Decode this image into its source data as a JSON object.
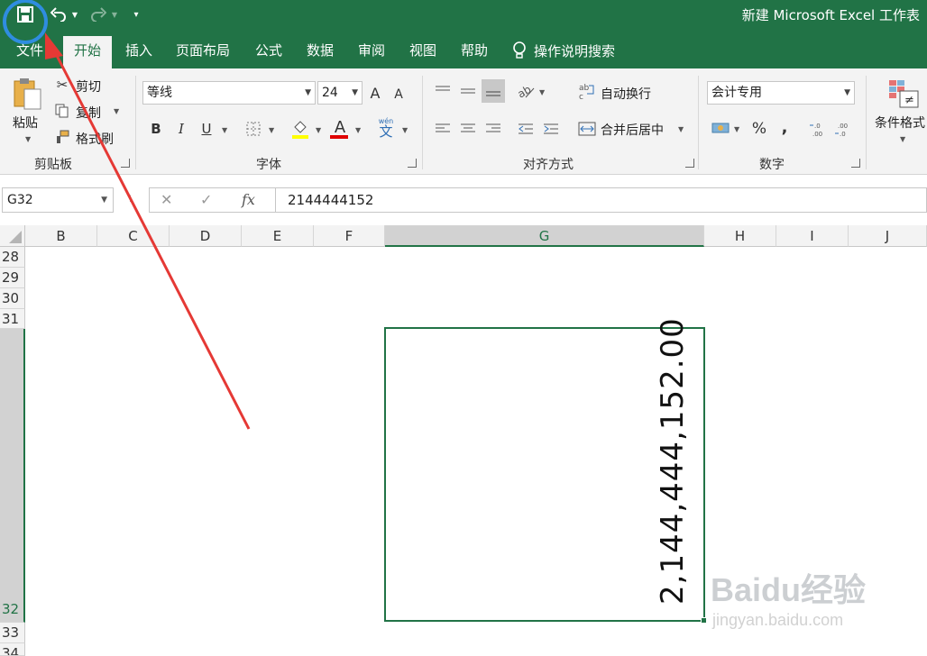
{
  "window": {
    "title": "新建 Microsoft Excel 工作表"
  },
  "tabs": [
    {
      "label": "文件"
    },
    {
      "label": "开始"
    },
    {
      "label": "插入"
    },
    {
      "label": "页面布局"
    },
    {
      "label": "公式"
    },
    {
      "label": "数据"
    },
    {
      "label": "审阅"
    },
    {
      "label": "视图"
    },
    {
      "label": "帮助"
    }
  ],
  "tell_me": {
    "label": "操作说明搜索"
  },
  "clipboard": {
    "paste": "粘贴",
    "cut": "剪切",
    "copy": "复制",
    "format_painter": "格式刷",
    "group": "剪贴板"
  },
  "font": {
    "name": "等线",
    "size": "24",
    "bold": "B",
    "italic": "I",
    "underline": "U",
    "grow": "A",
    "shrink": "A",
    "font_color": "A",
    "phonetic": "wén",
    "phonetic_char": "文",
    "group": "字体"
  },
  "alignment": {
    "wrap_text": "自动换行",
    "merge_center": "合并后居中",
    "group": "对齐方式"
  },
  "number": {
    "format": "会计专用",
    "percent": "%",
    "comma": ",",
    "group": "数字"
  },
  "styles": {
    "conditional_formatting": "条件格式"
  },
  "formula_bar": {
    "name_box": "G32",
    "cancel": "✕",
    "enter": "✓",
    "fx": "fx",
    "value": "2144444152"
  },
  "columns": [
    {
      "label": "B"
    },
    {
      "label": "C"
    },
    {
      "label": "D"
    },
    {
      "label": "E"
    },
    {
      "label": "F"
    },
    {
      "label": "G"
    },
    {
      "label": "H"
    },
    {
      "label": "I"
    },
    {
      "label": "J"
    }
  ],
  "rows": [
    {
      "label": "28"
    },
    {
      "label": "29"
    },
    {
      "label": "30"
    },
    {
      "label": "31"
    },
    {
      "label": "32"
    },
    {
      "label": "33"
    },
    {
      "label": "34"
    }
  ],
  "selected_cell": {
    "display": "2,144,444,152.00"
  },
  "watermark": {
    "logo": "Baidu经验",
    "url": "jingyan.baidu.com"
  },
  "colors": {
    "excel_green": "#217346",
    "annotation_red": "#e53935",
    "annotation_blue": "#2f8de0"
  }
}
